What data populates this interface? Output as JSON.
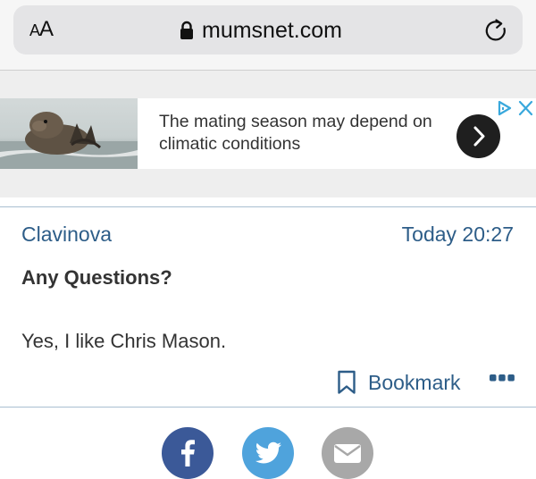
{
  "browser": {
    "text_size_label": "AA",
    "url": "mumsnet.com",
    "lock_icon": "lock-icon",
    "reload_icon": "reload-icon"
  },
  "ad": {
    "text": "The mating season may depend on climatic conditions",
    "image_subject": "otter eating in water",
    "arrow_icon": "chevron-right-icon",
    "choices_icon": "adchoices-icon",
    "close_icon": "close-icon"
  },
  "post": {
    "author": "Clavinova",
    "timestamp": "Today 20:27",
    "title": "Any Questions?",
    "body": "Yes, I like Chris Mason.",
    "bookmark_label": "Bookmark",
    "more_icon": "more-dots-icon"
  },
  "share": {
    "icons": [
      "facebook-icon",
      "twitter-icon",
      "email-icon"
    ]
  },
  "colors": {
    "link": "#2d5d88",
    "text": "#333333",
    "facebook": "#3b5998",
    "twitter": "#4fa3dc",
    "email": "#a8a8a8"
  }
}
